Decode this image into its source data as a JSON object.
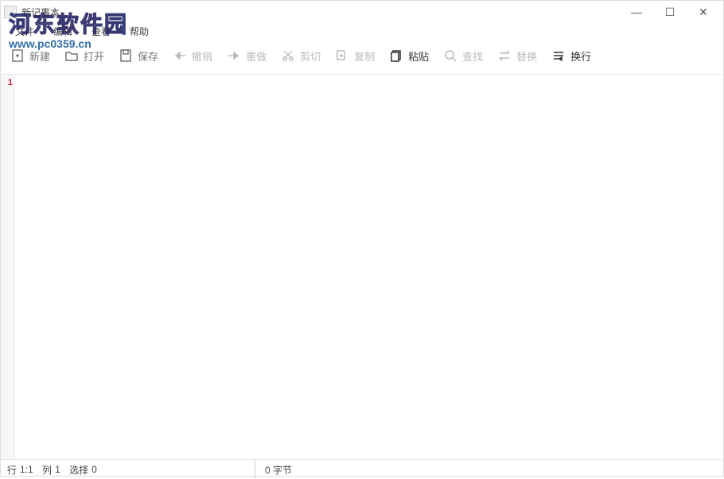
{
  "title": "新记事本",
  "menu": {
    "file": "文件",
    "edit": "编辑",
    "view": "查看",
    "help": "帮助"
  },
  "toolbar": {
    "new": "新建",
    "open": "打开",
    "save": "保存",
    "undo": "撤销",
    "redo": "重做",
    "cut": "剪切",
    "copy": "复制",
    "paste": "粘贴",
    "find": "查找",
    "replace": "替换",
    "wrap": "换行"
  },
  "editor": {
    "line_number": "1",
    "content": ""
  },
  "status": {
    "row_label": "行",
    "row_value": "1:1",
    "col_label": "列",
    "col_value": "1",
    "sel_label": "选择",
    "sel_value": "0",
    "size": "0 字节"
  },
  "watermark": {
    "text_big": "河东软件园",
    "text_small": "www.pc0359.cn"
  }
}
